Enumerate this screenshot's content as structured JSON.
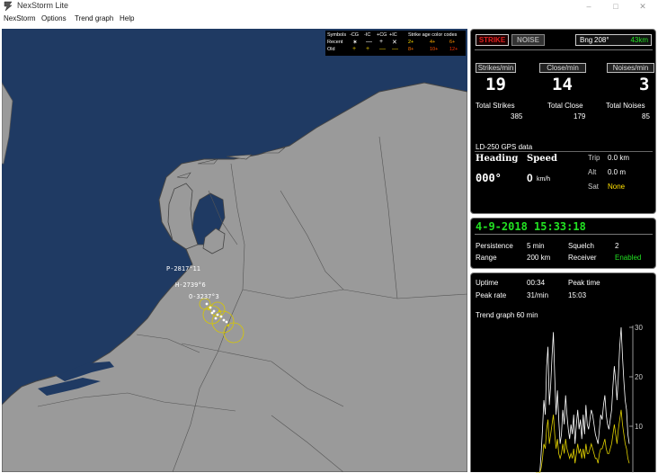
{
  "window": {
    "title": "NexStorm Lite",
    "minimize": "–",
    "maximize": "□",
    "close": "✕",
    "icon": "nexstorm-app-icon"
  },
  "menu": [
    "NexStorm",
    "Options",
    "Trend graph",
    "Help"
  ],
  "legend": {
    "symbols_label": "Symbols",
    "cols": [
      "-CG",
      "-IC",
      "+CG",
      "+IC"
    ],
    "recent_label": "Recent",
    "old_label": "Old",
    "recent_syms": [
      "✶",
      "—",
      "+",
      "✕"
    ],
    "old_syms": [
      "+",
      "+",
      "—",
      "—"
    ],
    "age_label": "Strike age color codes",
    "age_recent": [
      "2+",
      "4+",
      "6+"
    ],
    "age_old": [
      "8+",
      "10+",
      "12+"
    ]
  },
  "map_labels": [
    "P-2817°11",
    "H-2739°6",
    "O-3237°3"
  ],
  "status": {
    "strike": "STRIKE",
    "noise": "NOISE",
    "bearing_label": "Bng",
    "bearing": "208°",
    "distance": "43km"
  },
  "counters": {
    "strikes_btn": "Strikes/min",
    "close_btn": "Close/min",
    "noises_btn": "Noises/min",
    "strikes_val": "19",
    "close_val": "14",
    "noises_val": "3",
    "total_strikes_label": "Total Strikes",
    "total_close_label": "Total Close",
    "total_noises_label": "Total Noises",
    "total_strikes": "385",
    "total_close": "179",
    "total_noises": "85"
  },
  "gps": {
    "title": "LD-250 GPS data",
    "heading_label": "Heading",
    "speed_label": "Speed",
    "heading": "000°",
    "speed": "0",
    "speed_unit": "km/h",
    "trip_label": "Trip",
    "trip": "0.0 km",
    "alt_label": "Alt",
    "alt": "0.0 m",
    "sat_label": "Sat",
    "sat": "None"
  },
  "datetime": "4-9-2018 15:33:18",
  "settings": {
    "persistence_label": "Persistence",
    "persistence": "5 min",
    "squelch_label": "Squelch",
    "squelch": "2",
    "range_label": "Range",
    "range": "200 km",
    "receiver_label": "Receiver",
    "receiver": "Enabled"
  },
  "uptime": {
    "uptime_label": "Uptime",
    "uptime": "00:34",
    "peak_time_label": "Peak time",
    "peak_rate_label": "Peak rate",
    "peak_rate": "31/min",
    "peak_time": "15:03"
  },
  "trend": {
    "title": "Trend graph  60 min",
    "ticks": [
      "30",
      "20",
      "10"
    ]
  },
  "chart_data": {
    "type": "line",
    "ylim": [
      0,
      34
    ],
    "series": [
      {
        "values": [
          0,
          0,
          0,
          0,
          4,
          9,
          15,
          12,
          22,
          26,
          14,
          18,
          24,
          29,
          20,
          12,
          17,
          11,
          6,
          8,
          13,
          10,
          16,
          12,
          9,
          7,
          10,
          8,
          12,
          6,
          10,
          13,
          9,
          11,
          7,
          12,
          8,
          14,
          10,
          9,
          11,
          13,
          12,
          10,
          8,
          7,
          6,
          9,
          12,
          11,
          14,
          16,
          12,
          10,
          9,
          11,
          13,
          18,
          22,
          19,
          15,
          20,
          26,
          30,
          24,
          19,
          15,
          13,
          8,
          6
        ]
      },
      {
        "values": [
          0,
          0,
          0,
          0,
          1,
          3,
          6,
          5,
          9,
          11,
          6,
          8,
          10,
          12,
          8,
          5,
          7,
          4,
          3,
          4,
          6,
          4,
          7,
          5,
          4,
          3,
          4,
          3,
          5,
          2,
          4,
          6,
          4,
          5,
          3,
          5,
          3,
          6,
          4,
          4,
          5,
          6,
          5,
          4,
          3,
          3,
          2,
          4,
          5,
          5,
          6,
          7,
          5,
          4,
          4,
          5,
          6,
          8,
          10,
          8,
          6,
          9,
          11,
          13,
          10,
          8,
          6,
          5,
          3,
          2
        ]
      }
    ]
  }
}
